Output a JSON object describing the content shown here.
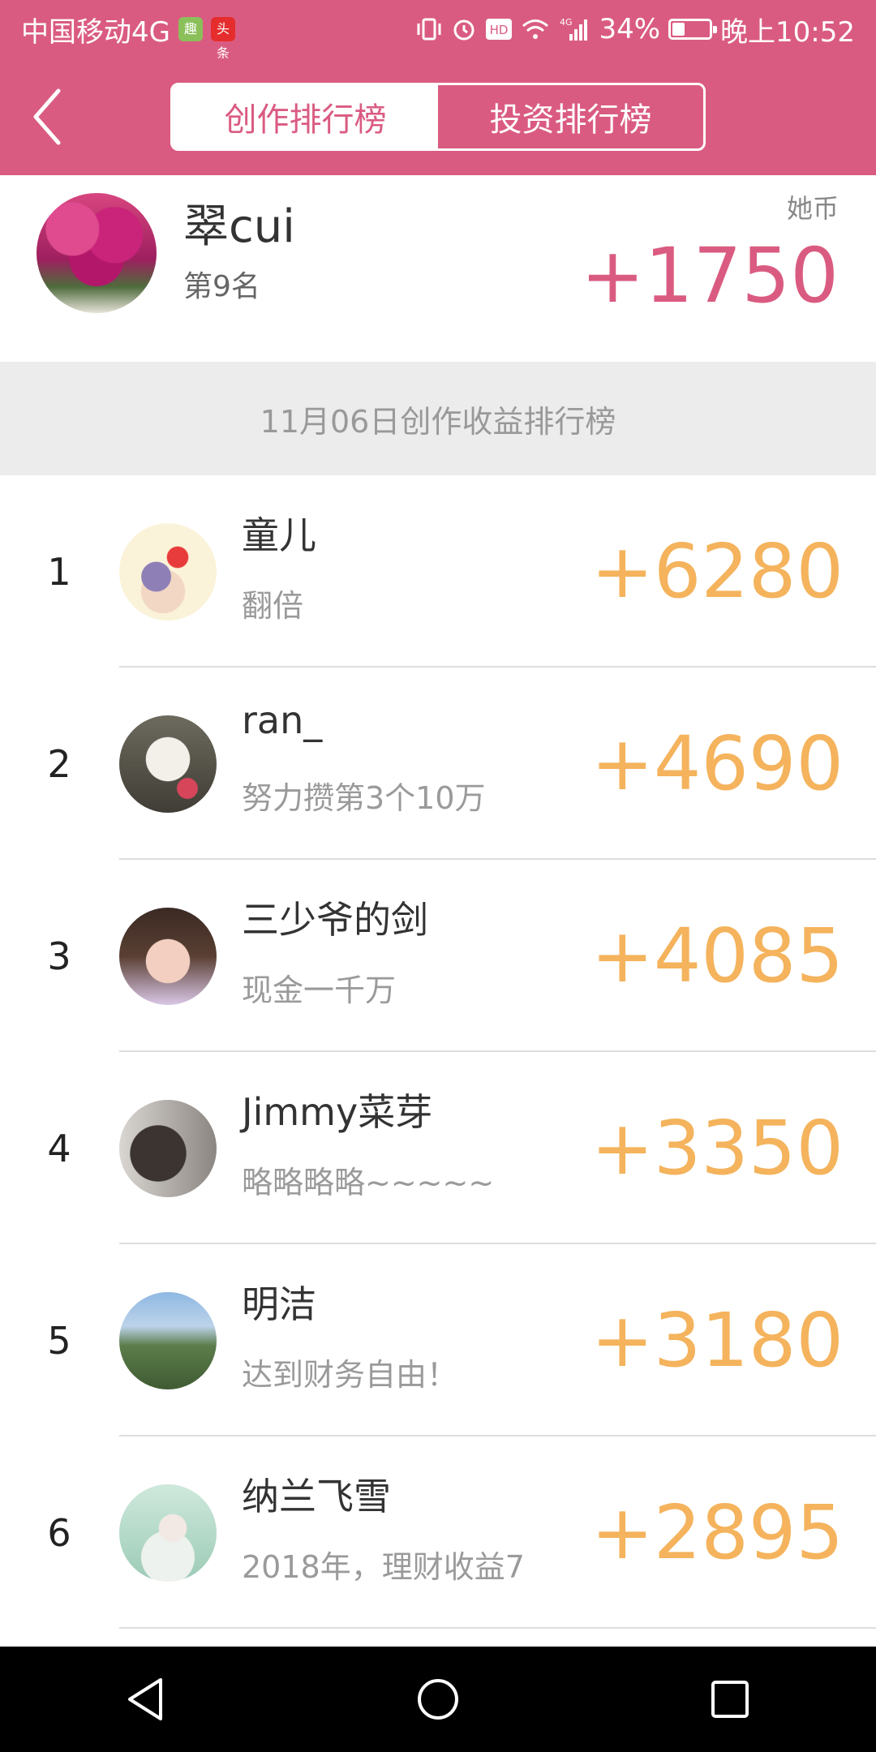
{
  "status_bar": {
    "carrier": "中国移动4G",
    "app_badge_1": "趣",
    "app_badge_2": "头条",
    "hd_label": "HD",
    "network_label": "4G",
    "battery_percent": "34%",
    "battery_level": 0.34,
    "time": "晚上10:52"
  },
  "header": {
    "tabs": [
      {
        "label": "创作排行榜",
        "active": true
      },
      {
        "label": "投资排行榜",
        "active": false
      }
    ]
  },
  "me": {
    "name": "翠cui",
    "rank": "第9名",
    "unit": "她币",
    "score": "+1750"
  },
  "section": {
    "title": "11月06日创作收益排行榜"
  },
  "leaderboard": [
    {
      "rank": "1",
      "name": "童儿",
      "motto": "翻倍",
      "score": "+6280"
    },
    {
      "rank": "2",
      "name": "ran_",
      "motto": "努力攒第3个10万",
      "score": "+4690"
    },
    {
      "rank": "3",
      "name": "三少爷的剑",
      "motto": "现金一千万",
      "score": "+4085"
    },
    {
      "rank": "4",
      "name": "Jimmy菜芽",
      "motto": "略略略略~~~~~",
      "score": "+3350"
    },
    {
      "rank": "5",
      "name": "明洁",
      "motto": "达到财务自由！",
      "score": "+3180"
    },
    {
      "rank": "6",
      "name": "纳兰飞雪",
      "motto": "2018年，理财收益7",
      "score": "+2895"
    }
  ],
  "colors": {
    "brand": "#da5b81",
    "score": "#f4b35c"
  },
  "icons": {
    "back": "chevron-left-icon",
    "nav_back": "triangle-back-icon",
    "nav_home": "circle-home-icon",
    "nav_recent": "square-recent-icon"
  }
}
